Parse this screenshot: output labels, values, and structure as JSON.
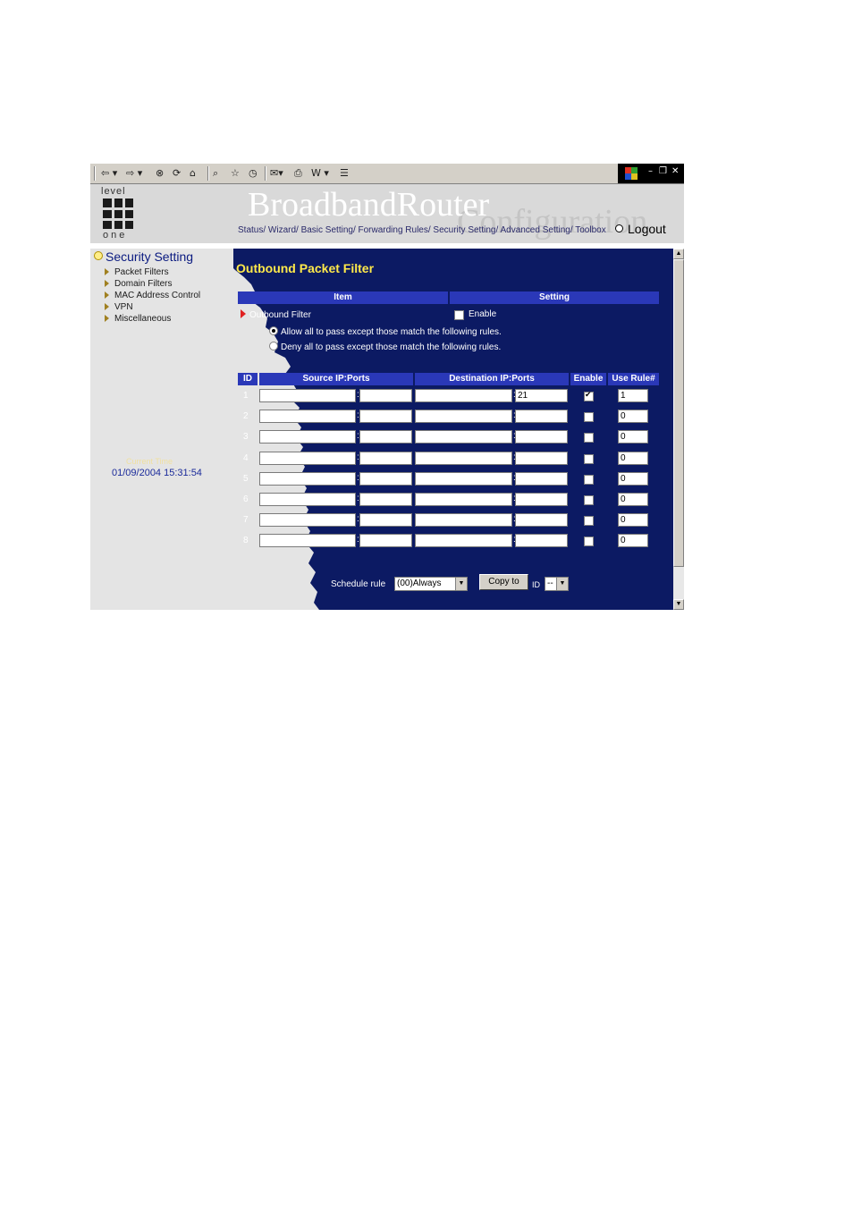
{
  "toolbar": {
    "back": "⇦ ▾",
    "forward": "⇨ ▾",
    "stop": "⊗",
    "refresh": "⟳",
    "home": "⌂",
    "search": "⌕",
    "favorites": "☆",
    "history": "◷",
    "mail": "✉▾",
    "print": "⎙",
    "edit": "W ▾",
    "discuss": "☰",
    "window_min": "–",
    "window_restore": "❐",
    "window_close": "✕"
  },
  "header": {
    "logo_top": "level",
    "logo_bottom": "one",
    "brand": "BroadbandRouter",
    "brand_sub": "Configuration",
    "nav": "Status/ Wizard/ Basic Setting/ Forwarding Rules/ Security Setting/ Advanced Setting/ Toolbox",
    "logout": "Logout"
  },
  "sidebar": {
    "title": "Security Setting",
    "items": [
      {
        "label": "Packet Filters"
      },
      {
        "label": "Domain Filters"
      },
      {
        "label": "MAC Address Control"
      },
      {
        "label": "VPN"
      },
      {
        "label": "Miscellaneous"
      }
    ],
    "time_label": "Current Time",
    "time_value": "01/09/2004 15:31:54"
  },
  "main": {
    "title": "Outbound Packet Filter",
    "item_header": "Item",
    "setting_header": "Setting",
    "filter_label": "Outbound Filter",
    "enable_label": "Enable",
    "enable_checked": false,
    "allow_text": "Allow all to pass except those match the following rules.",
    "deny_text": "Deny all to pass except those match the following rules.",
    "mode": "allow",
    "table": {
      "headers": [
        "ID",
        "Source IP:Ports",
        "Destination IP:Ports",
        "Enable",
        "Use Rule#"
      ],
      "rows": [
        {
          "id": "1",
          "src_ip": "",
          "src_port": "",
          "dst_ip": "",
          "dst_port": "21",
          "enabled": true,
          "rule": "1"
        },
        {
          "id": "2",
          "src_ip": "",
          "src_port": "",
          "dst_ip": "",
          "dst_port": "",
          "enabled": false,
          "rule": "0"
        },
        {
          "id": "3",
          "src_ip": "",
          "src_port": "",
          "dst_ip": "",
          "dst_port": "",
          "enabled": false,
          "rule": "0"
        },
        {
          "id": "4",
          "src_ip": "",
          "src_port": "",
          "dst_ip": "",
          "dst_port": "",
          "enabled": false,
          "rule": "0"
        },
        {
          "id": "5",
          "src_ip": "",
          "src_port": "",
          "dst_ip": "",
          "dst_port": "",
          "enabled": false,
          "rule": "0"
        },
        {
          "id": "6",
          "src_ip": "",
          "src_port": "",
          "dst_ip": "",
          "dst_port": "",
          "enabled": false,
          "rule": "0"
        },
        {
          "id": "7",
          "src_ip": "",
          "src_port": "",
          "dst_ip": "",
          "dst_port": "",
          "enabled": false,
          "rule": "0"
        },
        {
          "id": "8",
          "src_ip": "",
          "src_port": "",
          "dst_ip": "",
          "dst_port": "",
          "enabled": false,
          "rule": "0"
        }
      ]
    },
    "schedule_label": "Schedule rule",
    "schedule_value": "(00)Always",
    "copy_button": "Copy to",
    "id_label": "ID",
    "id_value": "--"
  },
  "colors": {
    "panel_bg": "#0c1a63",
    "header_bar": "#2a38b8",
    "title_yellow": "#ffe94a"
  }
}
